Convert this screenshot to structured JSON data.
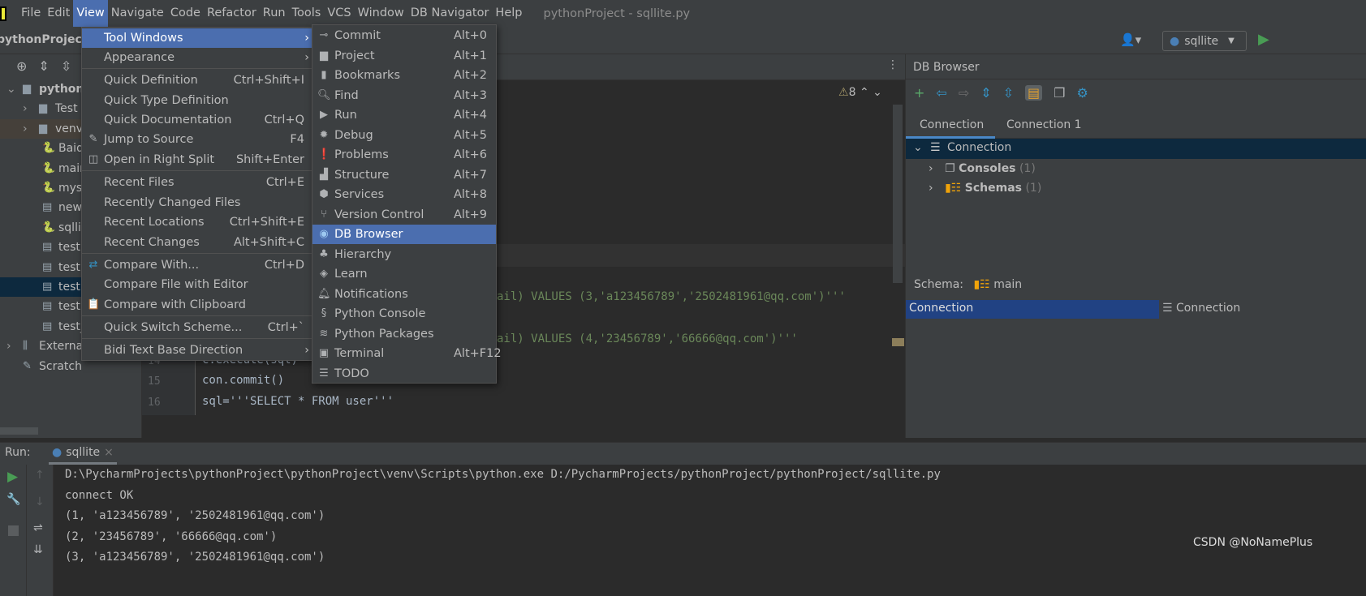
{
  "menubar": {
    "items": [
      "File",
      "Edit",
      "View",
      "Navigate",
      "Code",
      "Refactor",
      "Run",
      "Tools",
      "VCS",
      "Window",
      "DB Navigator",
      "Help"
    ],
    "active": "View",
    "window_title": "pythonProject - sqllite.py"
  },
  "navbar": {
    "breadcrumb": "pythonProject",
    "run_config": "sqllite"
  },
  "project": {
    "items": [
      {
        "label": "python",
        "icon": "folder-icon",
        "expanded": true
      },
      {
        "label": "Test",
        "icon": "folder-icon"
      },
      {
        "label": "venv",
        "icon": "folder-icon"
      },
      {
        "label": "Baid",
        "icon": "python-file-icon"
      },
      {
        "label": "mair",
        "icon": "python-file-icon"
      },
      {
        "label": "mys",
        "icon": "python-file-icon"
      },
      {
        "label": "new",
        "icon": "user-file-icon"
      },
      {
        "label": "sqlli",
        "icon": "python-file-icon"
      },
      {
        "label": "test.",
        "icon": "user-file-icon"
      },
      {
        "label": "test.",
        "icon": "text-file-icon"
      },
      {
        "label": "test",
        "icon": "user-file-icon",
        "selected": true
      },
      {
        "label": "test.",
        "icon": "user-file-icon"
      },
      {
        "label": "test_",
        "icon": "text-file-icon"
      },
      {
        "label": "Externa",
        "icon": "library-icon"
      },
      {
        "label": "Scratch",
        "icon": "scratch-icon"
      }
    ]
  },
  "editor": {
    "warnings": "8",
    "lines": [
      {
        "num": "",
        "code": "ail) VALUES (3,'a123456789','2502481961@qq.com')'''"
      },
      {
        "num": "",
        "code": "ail) VALUES (4,'23456789','66666@qq.com')'''"
      },
      {
        "num": "14",
        "code": "c.execute(sql)"
      },
      {
        "num": "15",
        "code": "con.commit()"
      },
      {
        "num": "16",
        "code": "sql='''SELECT * FROM user'''"
      }
    ]
  },
  "view_menu": {
    "items": [
      {
        "label": "Tool Windows",
        "shortcut": "",
        "submenu": true,
        "selected": true
      },
      {
        "label": "Appearance",
        "shortcut": "",
        "submenu": true
      },
      {
        "label": "Quick Definition",
        "shortcut": "Ctrl+Shift+I"
      },
      {
        "label": "Quick Type Definition",
        "shortcut": ""
      },
      {
        "label": "Quick Documentation",
        "shortcut": "Ctrl+Q"
      },
      {
        "label": "Jump to Source",
        "shortcut": "F4",
        "icon": "pencil-icon"
      },
      {
        "label": "Open in Right Split",
        "shortcut": "Shift+Enter",
        "icon": "split-icon"
      },
      {
        "label": "Recent Files",
        "shortcut": "Ctrl+E"
      },
      {
        "label": "Recently Changed Files",
        "shortcut": ""
      },
      {
        "label": "Recent Locations",
        "shortcut": "Ctrl+Shift+E"
      },
      {
        "label": "Recent Changes",
        "shortcut": "Alt+Shift+C"
      },
      {
        "label": "Compare With...",
        "shortcut": "Ctrl+D",
        "icon": "compare-icon"
      },
      {
        "label": "Compare File with Editor",
        "shortcut": ""
      },
      {
        "label": "Compare with Clipboard",
        "shortcut": "",
        "icon": "clipboard-compare-icon"
      },
      {
        "label": "Quick Switch Scheme...",
        "shortcut": "Ctrl+`"
      },
      {
        "label": "Bidi Text Base Direction",
        "shortcut": "",
        "submenu": true
      }
    ]
  },
  "tool_windows_menu": {
    "items": [
      {
        "label": "Commit",
        "shortcut": "Alt+0",
        "icon": "commit-icon"
      },
      {
        "label": "Project",
        "shortcut": "Alt+1",
        "icon": "folder-icon"
      },
      {
        "label": "Bookmarks",
        "shortcut": "Alt+2",
        "icon": "bookmark-icon"
      },
      {
        "label": "Find",
        "shortcut": "Alt+3",
        "icon": "search-icon"
      },
      {
        "label": "Run",
        "shortcut": "Alt+4",
        "icon": "play-icon"
      },
      {
        "label": "Debug",
        "shortcut": "Alt+5",
        "icon": "bug-icon"
      },
      {
        "label": "Problems",
        "shortcut": "Alt+6",
        "icon": "problems-icon"
      },
      {
        "label": "Structure",
        "shortcut": "Alt+7",
        "icon": "structure-icon"
      },
      {
        "label": "Services",
        "shortcut": "Alt+8",
        "icon": "services-icon"
      },
      {
        "label": "Version Control",
        "shortcut": "Alt+9",
        "icon": "branch-icon"
      },
      {
        "label": "DB Browser",
        "shortcut": "",
        "icon": "db-browser-icon",
        "selected": true
      },
      {
        "label": "Hierarchy",
        "shortcut": "",
        "icon": "hierarchy-icon"
      },
      {
        "label": "Learn",
        "shortcut": "",
        "icon": "learn-icon"
      },
      {
        "label": "Notifications",
        "shortcut": "",
        "icon": "bell-icon"
      },
      {
        "label": "Python Console",
        "shortcut": "",
        "icon": "python-icon"
      },
      {
        "label": "Python Packages",
        "shortcut": "",
        "icon": "layers-icon"
      },
      {
        "label": "Terminal",
        "shortcut": "Alt+F12",
        "icon": "terminal-icon"
      },
      {
        "label": "TODO",
        "shortcut": "",
        "icon": "list-icon"
      }
    ]
  },
  "db_browser": {
    "title": "DB Browser",
    "tabs": [
      "Connection",
      "Connection 1"
    ],
    "active_tab": "Connection",
    "tree": {
      "root": "Connection",
      "children": [
        {
          "label": "Consoles",
          "count": "(1)"
        },
        {
          "label": "Schemas",
          "count": "(1)"
        }
      ]
    },
    "schema_label": "Schema:",
    "schema_value": "main",
    "connection_left": "Connection",
    "connection_right": "Connection"
  },
  "run": {
    "label": "Run:",
    "tab": "sqllite",
    "output": [
      "D:\\PycharmProjects\\pythonProject\\pythonProject\\venv\\Scripts\\python.exe D:/PycharmProjects/pythonProject/pythonProject/sqllite.py",
      "connect OK",
      "(1, 'a123456789', '2502481961@qq.com')",
      "(2, '23456789', '66666@qq.com')",
      "(3, 'a123456789', '2502481961@qq.com')"
    ]
  },
  "watermark": "CSDN @NoNamePlus",
  "colors": {
    "accent": "#4b6eaf",
    "selection_dark": "#0d293e",
    "run_green": "#499c54",
    "string": "#6a8759"
  }
}
